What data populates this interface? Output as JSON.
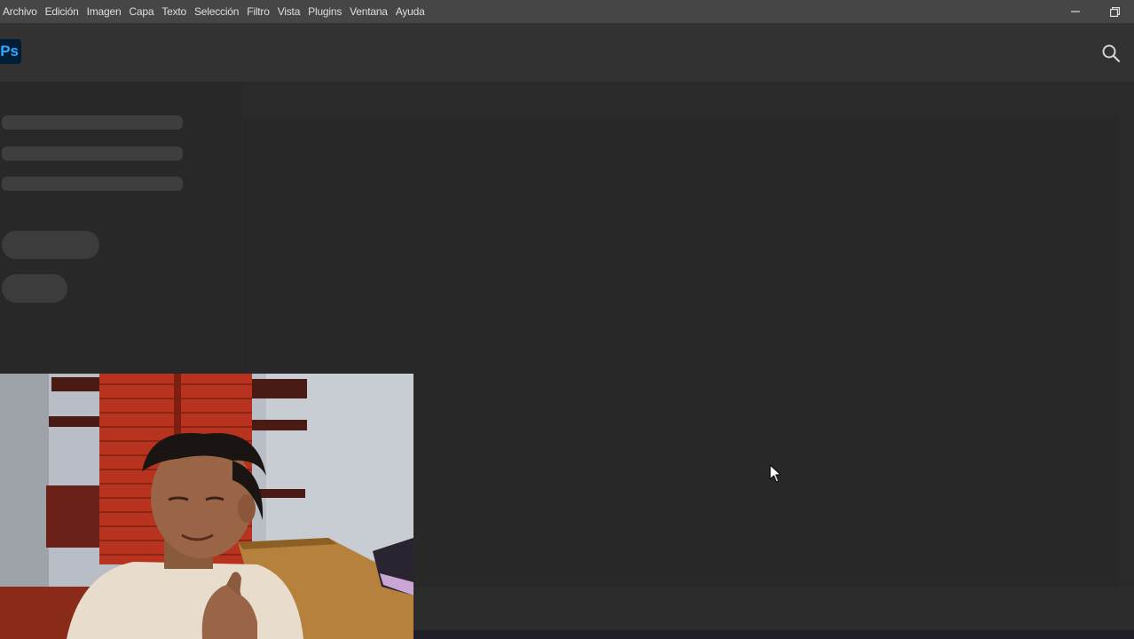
{
  "menubar": {
    "items": [
      "Archivo",
      "Edición",
      "Imagen",
      "Capa",
      "Texto",
      "Selección",
      "Filtro",
      "Vista",
      "Plugins",
      "Ventana",
      "Ayuda"
    ],
    "window_controls": [
      "minimize-icon",
      "restore-icon"
    ]
  },
  "header": {
    "logo_text": "Ps",
    "logo_color": "#31a8ff",
    "search_icon": "search-icon"
  },
  "colors": {
    "menubar_bg": "#464646",
    "header_bg": "#323232",
    "workspace_bg": "#2a2a2a",
    "skeleton": "#3e3e3e"
  },
  "webcam_overlay": {
    "icon": "webcam-video"
  },
  "cursor": {
    "icon": "pointer-arrow-icon"
  }
}
